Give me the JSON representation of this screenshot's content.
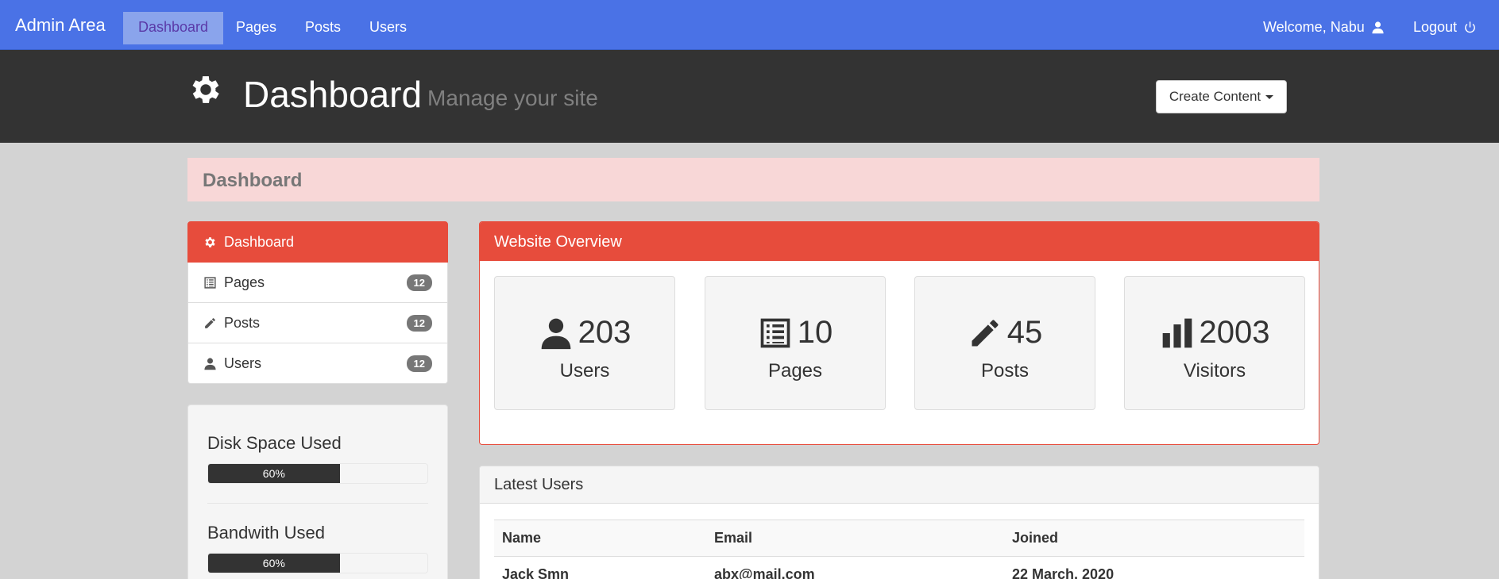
{
  "navbar": {
    "brand": "Admin Area",
    "links": [
      {
        "label": "Dashboard",
        "active": true
      },
      {
        "label": "Pages",
        "active": false
      },
      {
        "label": "Posts",
        "active": false
      },
      {
        "label": "Users",
        "active": false
      }
    ],
    "welcome": "Welcome, Nabu",
    "logout": "Logout"
  },
  "header": {
    "title": "Dashboard",
    "subtitle": "Manage your site",
    "create_button": "Create Content"
  },
  "breadcrumb": "Dashboard",
  "sidebar": {
    "items": [
      {
        "label": "Dashboard",
        "icon": "gear-icon",
        "badge": ""
      },
      {
        "label": "Pages",
        "icon": "list-icon",
        "badge": "12"
      },
      {
        "label": "Posts",
        "icon": "pencil-icon",
        "badge": "12"
      },
      {
        "label": "Users",
        "icon": "user-icon",
        "badge": "12"
      }
    ]
  },
  "usage": {
    "disk_title": "Disk Space Used",
    "disk_percent": "60%",
    "disk_fraction": 0.6,
    "bandwidth_title": "Bandwith Used",
    "bandwidth_percent": "60%",
    "bandwidth_fraction": 0.6
  },
  "overview": {
    "title": "Website Overview",
    "stats": [
      {
        "icon": "user-icon",
        "value": "203",
        "label": "Users"
      },
      {
        "icon": "list-icon",
        "value": "10",
        "label": "Pages"
      },
      {
        "icon": "pencil-icon",
        "value": "45",
        "label": "Posts"
      },
      {
        "icon": "bar-chart-icon",
        "value": "2003",
        "label": "Visitors"
      }
    ]
  },
  "latest_users": {
    "title": "Latest Users",
    "columns": [
      "Name",
      "Email",
      "Joined"
    ],
    "rows": [
      [
        "Jack Smn",
        "abx@mail.com",
        "22 March, 2020"
      ]
    ]
  },
  "colors": {
    "navbar": "#4a72e6",
    "header": "#333333",
    "accent": "#e74c3c",
    "breadcrumb_bg": "#f8d7d7"
  }
}
